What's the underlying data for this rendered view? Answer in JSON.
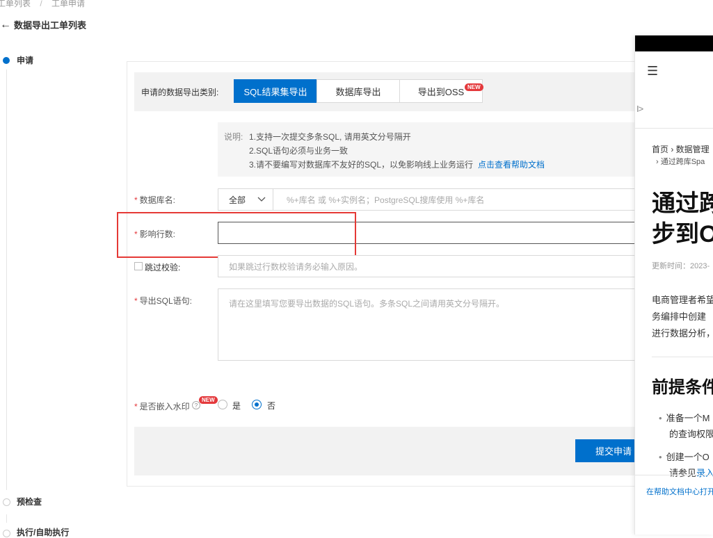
{
  "breadcrumb": {
    "items": [
      "工单列表",
      "工单申请"
    ],
    "separator": "/"
  },
  "header": {
    "back_arrow": "←",
    "title": "数据导出工单列表"
  },
  "steps": [
    {
      "label": "申请",
      "state": "active"
    },
    {
      "label": "预检查",
      "state": "pending"
    },
    {
      "label": "执行/自助执行",
      "state": "pending"
    }
  ],
  "export_type": {
    "label": "申请的数据导出类别:",
    "options": [
      {
        "label": "SQL结果集导出",
        "selected": true
      },
      {
        "label": "数据库导出",
        "selected": false
      },
      {
        "label": "导出到OSS",
        "selected": false,
        "badge": "NEW"
      }
    ]
  },
  "instructions": {
    "prefix": "说明:",
    "lines": [
      "1.支持一次提交多条SQL, 请用英文分号隔开",
      "2.SQL语句必须与业务一致",
      "3.请不要编写对数据库不友好的SQL，以免影响线上业务运行"
    ],
    "link": "点击查看帮助文档"
  },
  "form": {
    "required_mark": "*",
    "database": {
      "label": "数据库名:",
      "scope": "全部",
      "placeholder": "%+库名 或 %+实例名；PostgreSQL搜库使用 %+库名"
    },
    "affected_rows": {
      "label": "影响行数:",
      "value": ""
    },
    "skip_check": {
      "label": "跳过校验:",
      "checked": false,
      "placeholder": "如果跳过行数校验请务必输入原因。"
    },
    "sql": {
      "label": "导出SQL语句:",
      "placeholder": "请在这里填写您要导出数据的SQL语句。多条SQL之间请用英文分号隔开。"
    },
    "watermark": {
      "label": "是否嵌入水印",
      "badge": "NEW",
      "help": "?",
      "options": [
        "是",
        "否"
      ],
      "selected": "否"
    }
  },
  "submit": {
    "label": "提交申请"
  },
  "doc_panel": {
    "menu_icon": "☰",
    "collapse_icon": "I>",
    "breadcrumb_1": "首页  ›  数据管理",
    "breadcrumb_2": "›  通过跨库Spa",
    "title_line1": "通过跨",
    "title_line2": "步到O",
    "updated": "更新时间：2023-",
    "para": [
      "电商管理者希望",
      "务编排中创建",
      "进行数据分析，"
    ],
    "section": "前提条件",
    "bullets": [
      {
        "line1": "准备一个M",
        "line2": "的查询权限"
      },
      {
        "line1": "创建一个O",
        "line2": "请参见",
        "link": "录入"
      }
    ],
    "footer": "在帮助文档中心打开"
  },
  "colors": {
    "primary": "#0070cc",
    "required": "#e4393c",
    "highlight": "#e53935"
  }
}
